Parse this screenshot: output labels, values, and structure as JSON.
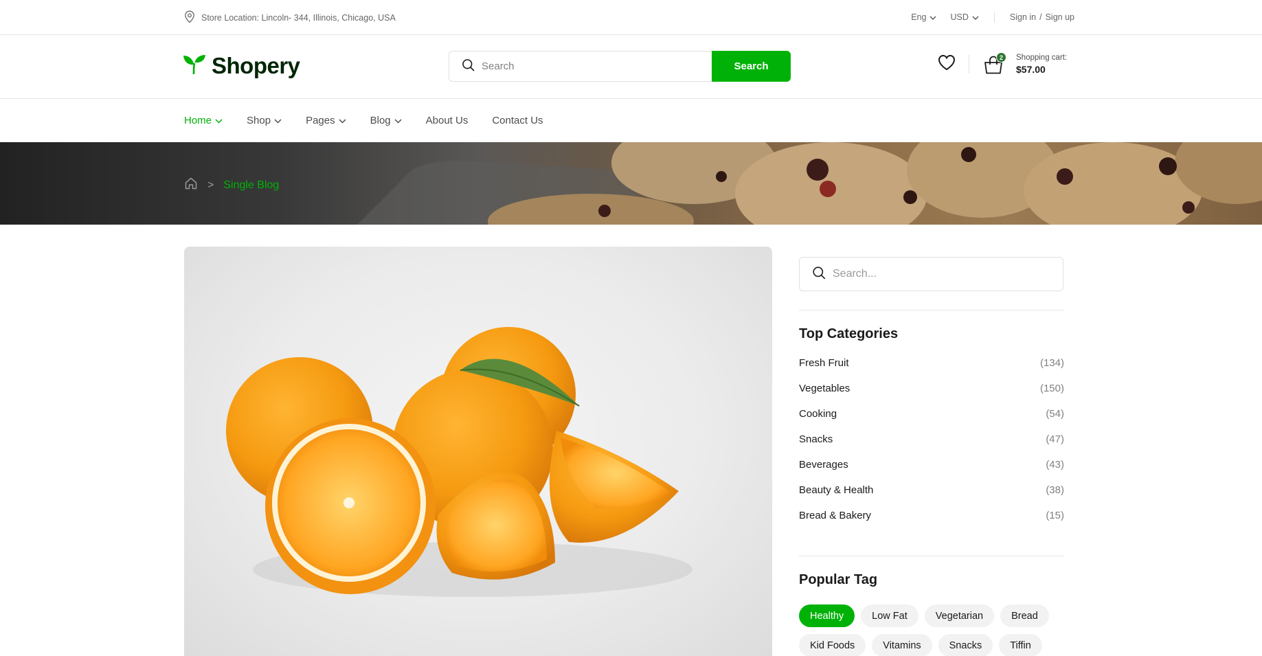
{
  "topbar": {
    "location": "Store Location: Lincoln- 344, Illinois, Chicago, USA",
    "language": "Eng",
    "currency": "USD",
    "sign_in": "Sign in",
    "auth_sep": "/",
    "sign_up": "Sign up"
  },
  "header": {
    "logo": "Shopery",
    "search_placeholder": "Search",
    "search_button": "Search",
    "cart_count": "2",
    "cart_label": "Shopping cart:",
    "cart_total": "$57.00"
  },
  "nav": {
    "items": [
      {
        "label": "Home",
        "dropdown": true,
        "active": true
      },
      {
        "label": "Shop",
        "dropdown": true
      },
      {
        "label": "Pages",
        "dropdown": true
      },
      {
        "label": "Blog",
        "dropdown": true
      },
      {
        "label": "About Us",
        "dropdown": false
      },
      {
        "label": "Contact Us",
        "dropdown": false
      }
    ]
  },
  "breadcrumb": {
    "separator": ">",
    "current": "Single Blog"
  },
  "sidebar": {
    "search_placeholder": "Search...",
    "categories_title": "Top Categories",
    "categories": [
      {
        "name": "Fresh Fruit",
        "count": "(134)"
      },
      {
        "name": "Vegetables",
        "count": "(150)"
      },
      {
        "name": "Cooking",
        "count": "(54)"
      },
      {
        "name": "Snacks",
        "count": "(47)"
      },
      {
        "name": "Beverages",
        "count": "(43)"
      },
      {
        "name": "Beauty & Health",
        "count": "(38)"
      },
      {
        "name": "Bread & Bakery",
        "count": "(15)"
      }
    ],
    "tags_title": "Popular Tag",
    "tags": [
      "Healthy",
      "Low Fat",
      "Vegetarian",
      "Bread",
      "Kid Foods",
      "Vitamins",
      "Snacks",
      "Tiffin"
    ]
  },
  "colors": {
    "accent": "#00b207",
    "dark_green": "#002603",
    "badge": "#2c742f"
  }
}
